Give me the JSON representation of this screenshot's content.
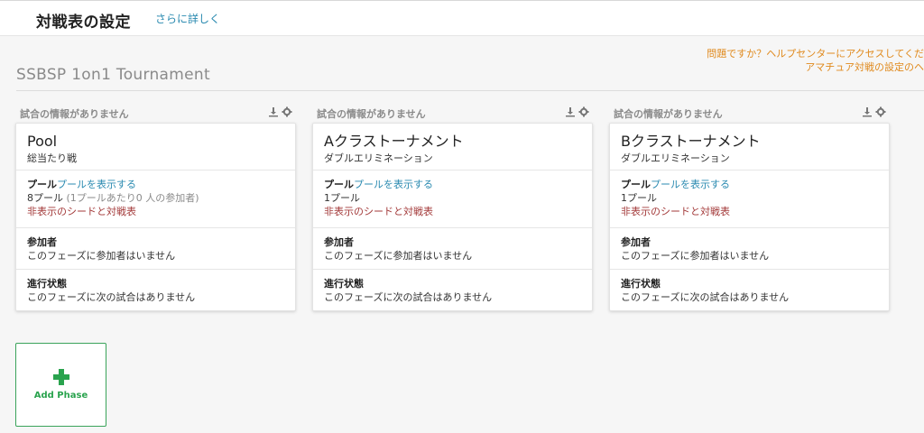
{
  "header": {
    "title": "対戦表の設定",
    "more_link": "さらに詳しく"
  },
  "help": {
    "line1": "問題ですか？ヘルプセンターにアクセスしてくだ",
    "line2": "アマチュア対戦の設定のヘ"
  },
  "tournament": {
    "title": "SSBSP 1on1 Tournament"
  },
  "phases": [
    {
      "status": "試合の情報がありません",
      "name": "Pool",
      "type": "総当たり戦",
      "pool_label": "プール",
      "pool_link": "プールを表示する",
      "pool_count": "8プール",
      "pool_detail": " (1プールあたり0 人の参加者)",
      "hidden_link": "非表示のシードと対戦表",
      "participants_label": "参加者",
      "participants_text": "このフェーズに参加者はいません",
      "progress_label": "進行状態",
      "progress_text": "このフェーズに次の試合はありません"
    },
    {
      "status": "試合の情報がありません",
      "name": "Aクラストーナメント",
      "type": "ダブルエリミネーション",
      "pool_label": "プール",
      "pool_link": "プールを表示する",
      "pool_count": "1プール",
      "pool_detail": "",
      "hidden_link": "非表示のシードと対戦表",
      "participants_label": "参加者",
      "participants_text": "このフェーズに参加者はいません",
      "progress_label": "進行状態",
      "progress_text": "このフェーズに次の試合はありません"
    },
    {
      "status": "試合の情報がありません",
      "name": "Bクラストーナメント",
      "type": "ダブルエリミネーション",
      "pool_label": "プール",
      "pool_link": "プールを表示する",
      "pool_count": "1プール",
      "pool_detail": "",
      "hidden_link": "非表示のシードと対戦表",
      "participants_label": "参加者",
      "participants_text": "このフェーズに参加者はいません",
      "progress_label": "進行状態",
      "progress_text": "このフェーズに次の試合はありません"
    }
  ],
  "add_phase": {
    "label": "Add Phase"
  },
  "icons": {
    "download": "download-icon",
    "settings": "gear-icon",
    "add": "plus-icon"
  },
  "colors": {
    "link": "#2a8ab0",
    "help": "#e08a1e",
    "warning_link": "#a33a3a",
    "add_accent": "#2aa34e"
  }
}
